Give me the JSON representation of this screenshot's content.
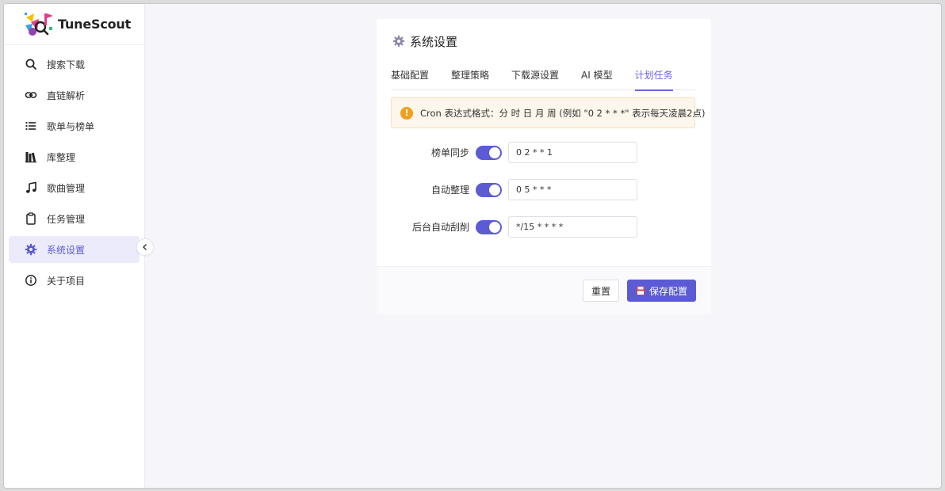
{
  "app": {
    "name": "TuneScout"
  },
  "sidebar": {
    "items": [
      {
        "label": "搜索下载",
        "icon": "search-icon"
      },
      {
        "label": "直链解析",
        "icon": "link-icon"
      },
      {
        "label": "歌单与榜单",
        "icon": "list-icon"
      },
      {
        "label": "库整理",
        "icon": "library-icon"
      },
      {
        "label": "歌曲管理",
        "icon": "music-note-icon"
      },
      {
        "label": "任务管理",
        "icon": "clipboard-icon"
      },
      {
        "label": "系统设置",
        "icon": "gear-icon",
        "active": true
      },
      {
        "label": "关于项目",
        "icon": "info-icon"
      }
    ],
    "collapse_icon": "chevron-left-icon"
  },
  "card": {
    "title": "系统设置",
    "title_icon": "gear-icon",
    "tabs": [
      {
        "label": "基础配置"
      },
      {
        "label": "整理策略"
      },
      {
        "label": "下载源设置"
      },
      {
        "label": "AI 模型"
      },
      {
        "label": "计划任务",
        "active": true
      }
    ],
    "alert": {
      "icon": "warning-icon",
      "text": "Cron 表达式格式：分 时 日 月 周 (例如 \"0 2 * * *\" 表示每天凌晨2点)"
    },
    "schedules": [
      {
        "label": "榜单同步",
        "enabled": true,
        "cron": "0 2 * * 1"
      },
      {
        "label": "自动整理",
        "enabled": true,
        "cron": "0 5 * * *"
      },
      {
        "label": "后台自动刮削",
        "enabled": true,
        "cron": "*/15 * * * *"
      }
    ],
    "buttons": {
      "reset": "重置",
      "save": "保存配置",
      "save_icon": "floppy-disk-icon"
    }
  },
  "colors": {
    "accent": "#5b5bd6",
    "warning": "#f0a020",
    "alert_bg": "#fdf6ec"
  }
}
